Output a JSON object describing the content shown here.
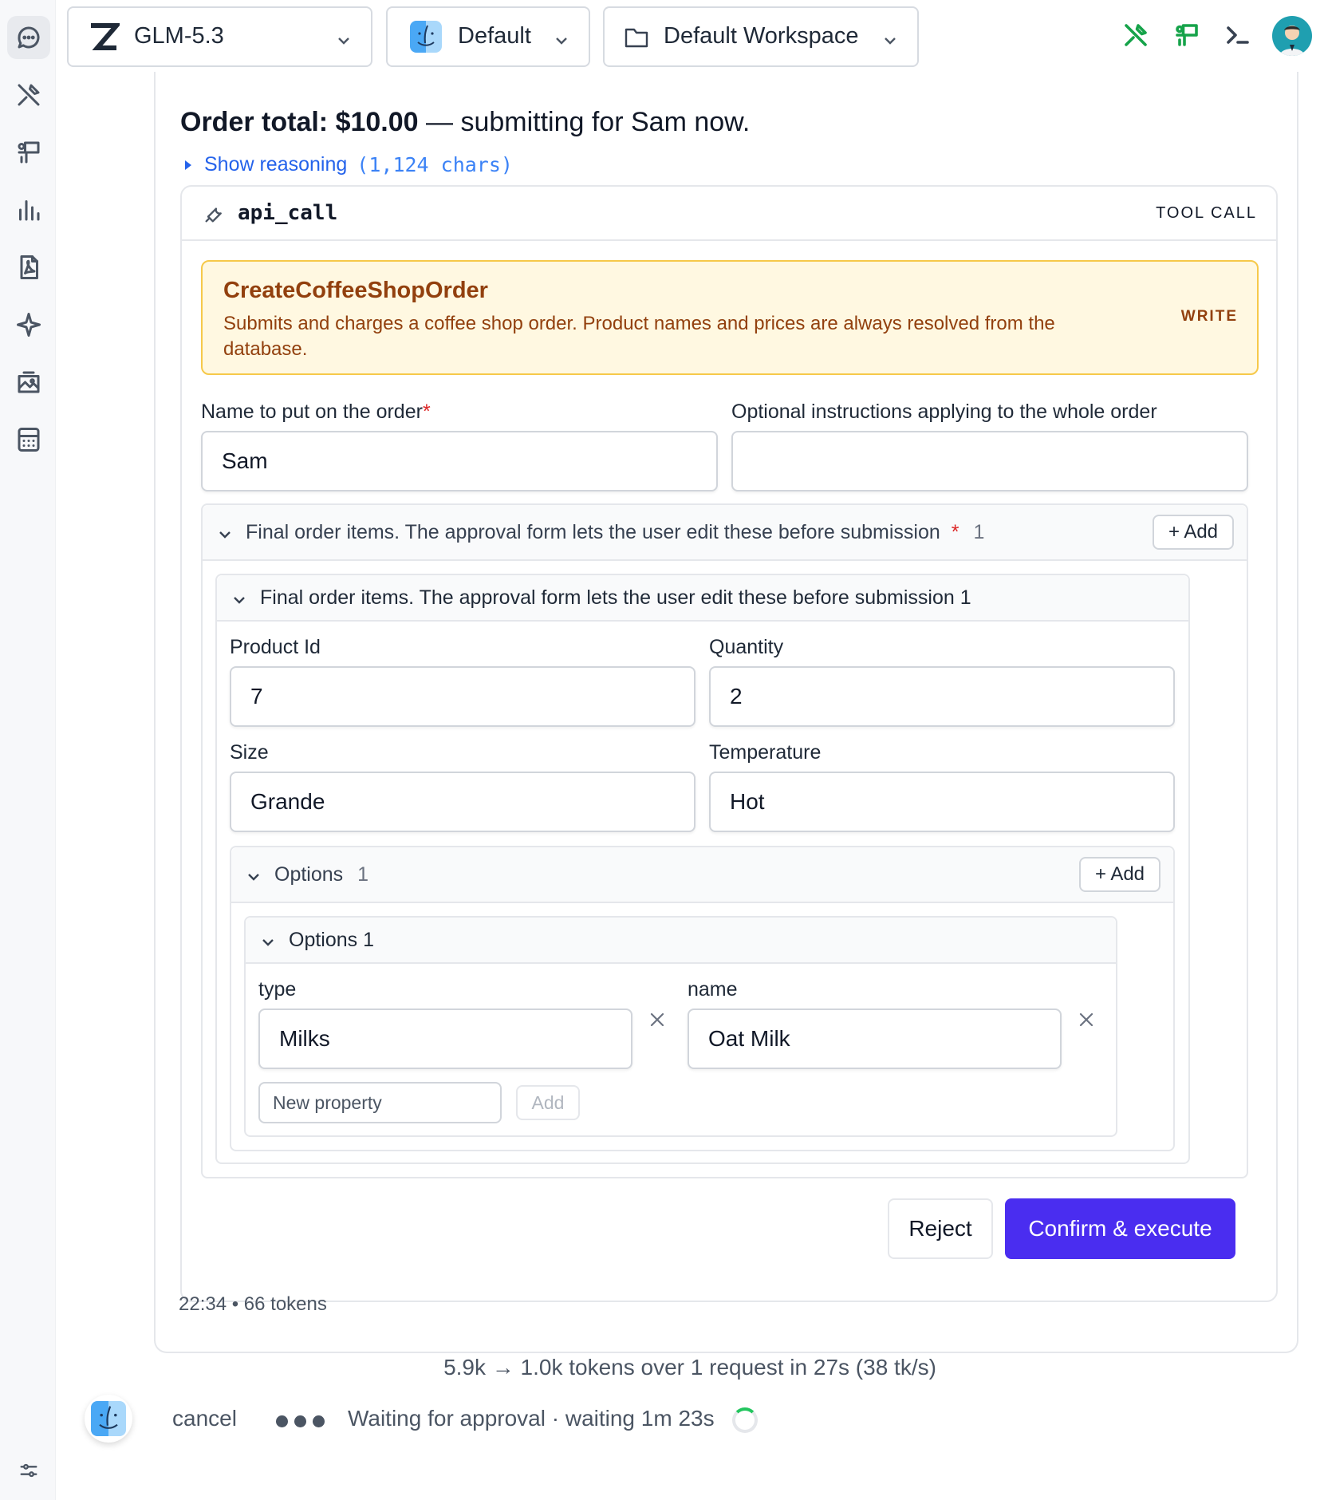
{
  "toolbar": {
    "model_label": "GLM-5.3",
    "profile_label": "Default",
    "workspace_label": "Default Workspace"
  },
  "rail": {
    "icons": [
      "chat-icon",
      "tools-icon",
      "presentation-icon",
      "chart-icon",
      "pdf-icon",
      "sparkle-icon",
      "image-gallery-icon",
      "calculator-icon",
      "sliders-icon"
    ]
  },
  "message": {
    "total_label": "Order total: $10.00",
    "total_suffix": " — submitting for Sam now.",
    "reasoning_label": "Show reasoning",
    "reasoning_chars": "(1,124 chars)",
    "meta": "22:34 • 66 tokens"
  },
  "tool_call": {
    "name": "api_call",
    "tag": "TOOL CALL",
    "operation_title": "CreateCoffeeShopOrder",
    "operation_desc": "Submits and charges a coffee shop order. Product names and prices are always resolved from the database.",
    "operation_badge": "WRITE",
    "fields": {
      "name_label": "Name to put on the order",
      "name_required": "*",
      "name_value": "Sam",
      "instructions_label": "Optional instructions applying to the whole order",
      "instructions_value": ""
    },
    "items_group": {
      "label": "Final order items. The approval form lets the user edit these before submission",
      "required": "*",
      "count": "1",
      "add_label": "+ Add",
      "item_label": "Final order items. The approval form lets the user edit these before submission 1",
      "product_id_label": "Product Id",
      "product_id_value": "7",
      "quantity_label": "Quantity",
      "quantity_value": "2",
      "size_label": "Size",
      "size_value": "Grande",
      "temperature_label": "Temperature",
      "temperature_value": "Hot"
    },
    "options_group": {
      "label": "Options",
      "count": "1",
      "add_label": "+ Add",
      "item_label": "Options 1",
      "type_label": "type",
      "type_value": "Milks",
      "name_label": "name",
      "name_value": "Oat Milk",
      "new_property_placeholder": "New property",
      "new_property_add": "Add"
    },
    "reject_label": "Reject",
    "confirm_label": "Confirm & execute"
  },
  "footer": {
    "usage": "5.9k → 1.0k tokens over 1 request in 27s (38 tk/s)",
    "cancel_label": "cancel",
    "waiting": "Waiting for approval · waiting 1m 23s"
  },
  "colors": {
    "accent": "#4a2df0",
    "warning_bg": "#fff8e1",
    "warning_border": "#f6c94a",
    "warning_text": "#92400e",
    "link": "#2563eb",
    "tool_green": "#16a34a"
  }
}
